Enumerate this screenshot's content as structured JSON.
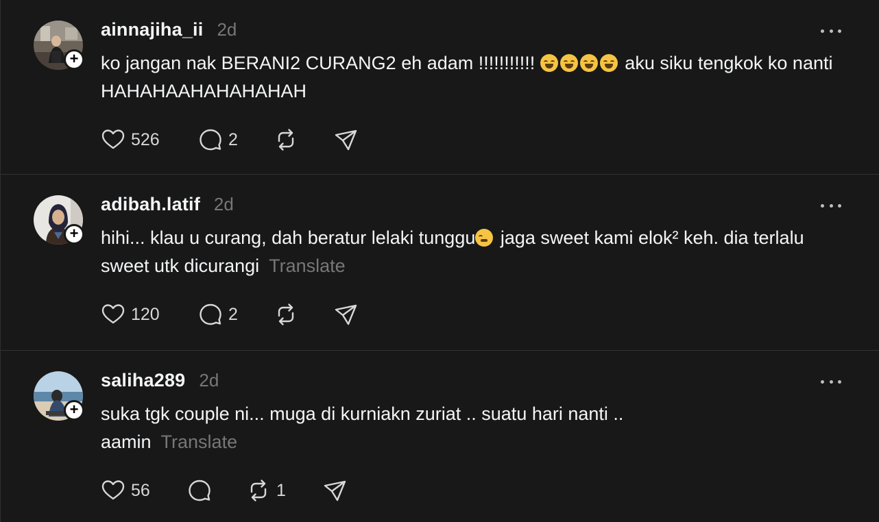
{
  "posts": [
    {
      "username": "ainnajiha_ii",
      "time": "2d",
      "text_parts": [
        "ko jangan nak BERANI2 CURANG2 eh adam !!!!!!!!!!! ",
        " aku siku tengkok ko nanti HAHAHAAHAHAHAHAH"
      ],
      "emoji": "rolling-on-floor-laughing x4",
      "likes": "526",
      "replies": "2",
      "reposts": "",
      "translate": ""
    },
    {
      "username": "adibah.latif",
      "time": "2d",
      "text_parts": [
        "hihi... klau u curang, dah beratur lelaki tunggu",
        " jaga sweet kami elok² keh. dia terlalu sweet utk dicurangi"
      ],
      "emoji": "face-with-hand-over-mouth",
      "likes": "120",
      "replies": "2",
      "reposts": "",
      "translate": "Translate"
    },
    {
      "username": "saliha289",
      "time": "2d",
      "text_parts": [
        "suka tgk couple ni... muga di kurniakn zuriat .. suatu hari nanti .. aamin"
      ],
      "likes": "56",
      "replies": "",
      "reposts": "1",
      "translate": "Translate"
    }
  ],
  "icons": {
    "like": "heart-icon",
    "reply": "comment-icon",
    "repost": "repost-icon",
    "share": "share-icon",
    "more": "more-icon",
    "follow": "plus-icon"
  },
  "colors": {
    "background": "#181818",
    "text": "#f3f5f7",
    "muted": "#777777",
    "divider": "#333333"
  }
}
